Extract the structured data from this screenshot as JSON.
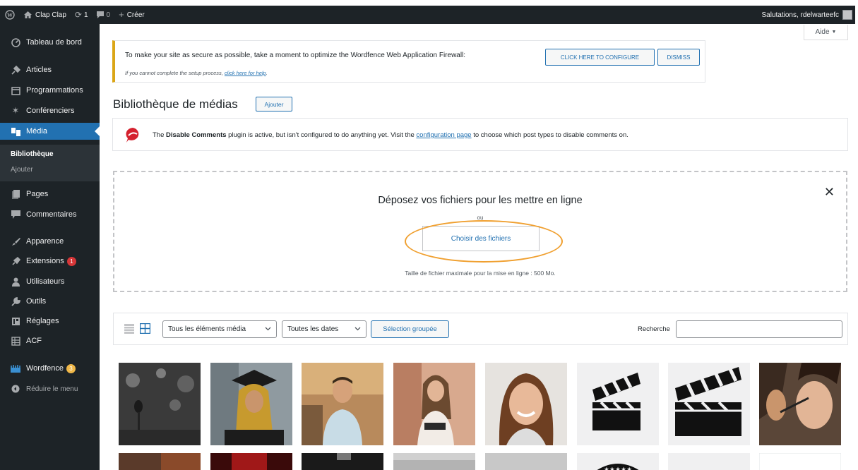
{
  "admin_bar": {
    "site_name": "Clap Clap",
    "updates_count": "1",
    "comments_count": "0",
    "new_label": "Créer",
    "greeting": "Salutations, rdelwarteefc"
  },
  "sidebar": {
    "items": [
      {
        "label": "Tableau de bord",
        "icon": "dashboard-icon"
      },
      {
        "label": "Articles",
        "icon": "pin-icon"
      },
      {
        "label": "Programmations",
        "icon": "calendar-icon"
      },
      {
        "label": "Conférenciers",
        "icon": "star-icon"
      },
      {
        "label": "Média",
        "icon": "media-icon"
      },
      {
        "label": "Pages",
        "icon": "pages-icon"
      },
      {
        "label": "Commentaires",
        "icon": "comment-icon"
      },
      {
        "label": "Apparence",
        "icon": "brush-icon"
      },
      {
        "label": "Extensions",
        "icon": "plugin-icon",
        "badge": "1"
      },
      {
        "label": "Utilisateurs",
        "icon": "users-icon"
      },
      {
        "label": "Outils",
        "icon": "wrench-icon"
      },
      {
        "label": "Réglages",
        "icon": "settings-icon"
      },
      {
        "label": "ACF",
        "icon": "acf-icon"
      },
      {
        "label": "Wordfence",
        "icon": "wordfence-icon",
        "badge": "3"
      },
      {
        "label": "Réduire le menu",
        "icon": "collapse-icon"
      }
    ],
    "submenu": [
      "Bibliothèque",
      "Ajouter"
    ]
  },
  "help_tab": "Aide",
  "wordfence_notice": {
    "message": "To make your site as secure as possible, take a moment to optimize the Wordfence Web Application Firewall:",
    "configure_label": "CLICK HERE TO CONFIGURE",
    "dismiss_label": "DISMISS",
    "sub_prefix": "If you cannot complete the setup process, ",
    "sub_link": "click here for help",
    "sub_suffix": "."
  },
  "page": {
    "title": "Bibliothèque de médias",
    "add_label": "Ajouter"
  },
  "disable_comments_notice": {
    "prefix": "The ",
    "plugin": "Disable Comments",
    "middle": " plugin is active, but isn't configured to do anything yet. Visit the ",
    "link": "configuration page",
    "suffix": " to choose which post types to disable comments on."
  },
  "uploader": {
    "title": "Déposez vos fichiers pour les mettre en ligne",
    "or": "ou",
    "choose_label": "Choisir des fichiers",
    "max_size": "Taille de fichier maximale pour la mise en ligne : 500 Mo."
  },
  "toolbar": {
    "type_filter": "Tous les éléments média",
    "date_filter": "Toutes les dates",
    "bulk_label": "Sélection groupée",
    "search_label": "Recherche",
    "search_value": ""
  },
  "colors": {
    "admin_dark": "#1d2327",
    "accent": "#2271b1",
    "warning": "#dba617",
    "highlight": "#f0a030"
  }
}
